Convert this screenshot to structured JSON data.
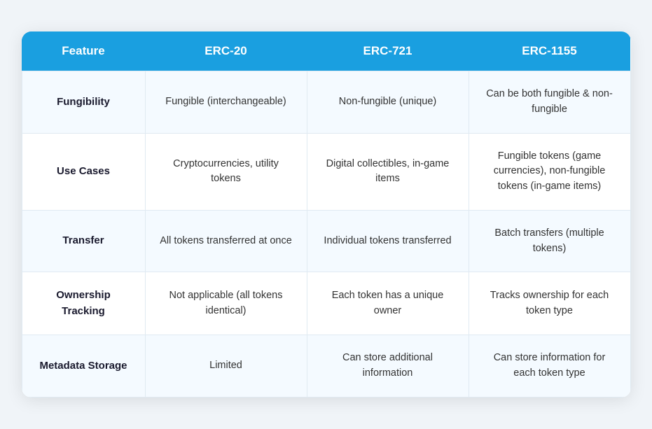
{
  "header": {
    "col1": "Feature",
    "col2": "ERC-20",
    "col3": "ERC-721",
    "col4": "ERC-1155"
  },
  "rows": [
    {
      "feature": "Fungibility",
      "erc20": "Fungible (interchangeable)",
      "erc721": "Non-fungible (unique)",
      "erc1155": "Can be both fungible & non-fungible"
    },
    {
      "feature": "Use Cases",
      "erc20": "Cryptocurrencies, utility tokens",
      "erc721": "Digital collectibles, in-game items",
      "erc1155": "Fungible tokens (game currencies), non-fungible tokens (in-game items)"
    },
    {
      "feature": "Transfer",
      "erc20": "All tokens transferred at once",
      "erc721": "Individual tokens transferred",
      "erc1155": "Batch transfers (multiple tokens)"
    },
    {
      "feature": "Ownership Tracking",
      "erc20": "Not applicable (all tokens identical)",
      "erc721": "Each token has a unique owner",
      "erc1155": "Tracks ownership for each token type"
    },
    {
      "feature": "Metadata Storage",
      "erc20": "Limited",
      "erc721": "Can store additional information",
      "erc1155": "Can store information for each token type"
    }
  ]
}
